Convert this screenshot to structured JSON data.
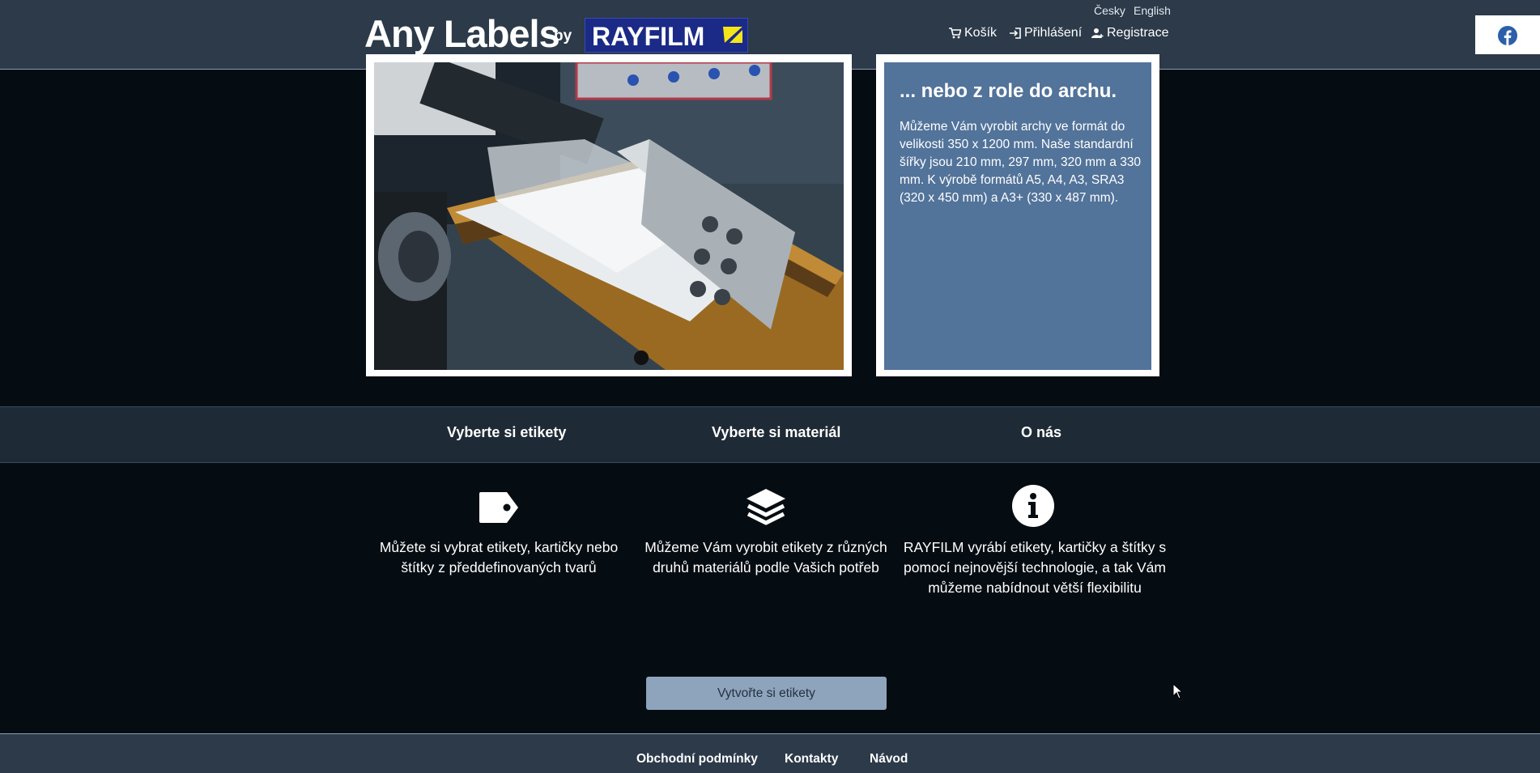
{
  "header": {
    "logo_text": "Any Labels",
    "logo_by": "by",
    "brand_name": "RAYFILM",
    "languages": [
      "Česky",
      "English"
    ],
    "nav": {
      "cart": "Košík",
      "login": "Přihlášení",
      "register": "Registrace"
    }
  },
  "hero": {
    "title": "... nebo z role do archu.",
    "body": "Můžeme Vám vyrobit archy ve formát do velikosti 350 x 1200 mm. Naše standardní šířky jsou 210 mm, 297 mm, 320 mm a 330 mm. K výrobě formátů A5, A4, A3, SRA3 (320 x 450 mm) a A3+ (330 x 487 mm)."
  },
  "tabs": [
    "Vyberte si etikety",
    "Vyberte si materiál",
    "O nás"
  ],
  "features": [
    {
      "icon": "tag-icon",
      "text": "Můžete si vybrat etikety, kartičky nebo štítky z předdefinovaných tvarů"
    },
    {
      "icon": "layers-icon",
      "text": "Můžeme Vám vyrobit etikety z různých druhů materiálů podle Vašich potřeb"
    },
    {
      "icon": "info-icon",
      "text": "RAYFILM vyrábí etikety, kartičky a štítky s pomocí nejnovější technologie, a tak Vám můžeme nabídnout větší flexibilitu"
    }
  ],
  "cta_label": "Vytvořte si etikety",
  "footer": [
    "Obchodní podmínky",
    "Kontakty",
    "Návod"
  ],
  "colors": {
    "header_bg": "#2c3a4a",
    "page_bg": "#060d12",
    "info_panel": "#52739a",
    "cta_bg": "#8ea4bd",
    "brand_blue": "#1b2a86",
    "brand_yellow": "#f5e61a"
  }
}
